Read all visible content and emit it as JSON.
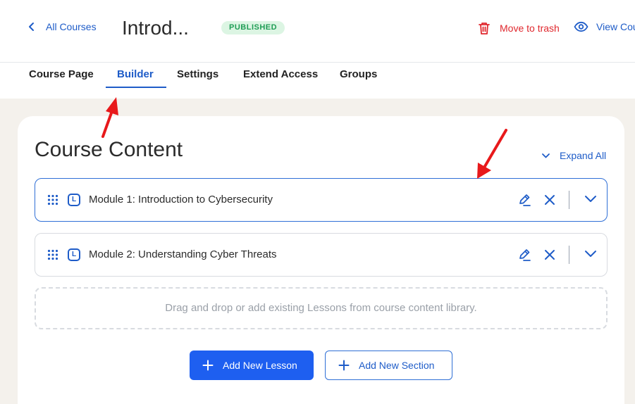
{
  "header": {
    "back_label": "All Courses",
    "course_title": "Introd...",
    "status_badge": "PUBLISHED",
    "trash_label": "Move to trash",
    "view_label": "View Cou"
  },
  "tabs": [
    {
      "label": "Course Page"
    },
    {
      "label": "Builder",
      "active": true
    },
    {
      "label": "Settings"
    },
    {
      "label": "Extend Access"
    },
    {
      "label": "Groups"
    }
  ],
  "content": {
    "title": "Course Content",
    "expand_all": "Expand All",
    "lesson_icon_letter": "L",
    "modules": [
      {
        "title": "Module 1: Introduction to Cybersecurity"
      },
      {
        "title": "Module 2: Understanding Cyber Threats"
      }
    ],
    "dropzone_text": "Drag and drop or add existing Lessons from course content library.",
    "add_lesson_label": "Add New Lesson",
    "add_section_label": "Add New Section"
  },
  "colors": {
    "accent": "#1e5cc8",
    "primary_button": "#1e5ff0",
    "danger": "#e0282e",
    "badge_bg": "#dcf5e3",
    "badge_text": "#1f9d55",
    "annotation_arrow": "#e8191b",
    "page_bg": "#f4f1ec"
  },
  "icons": [
    "chevron-left-icon",
    "trash-icon",
    "eye-icon",
    "chevron-down-icon",
    "drag-handle-icon",
    "lesson-icon",
    "edit-icon",
    "close-icon",
    "plus-icon",
    "annotation-arrow"
  ]
}
